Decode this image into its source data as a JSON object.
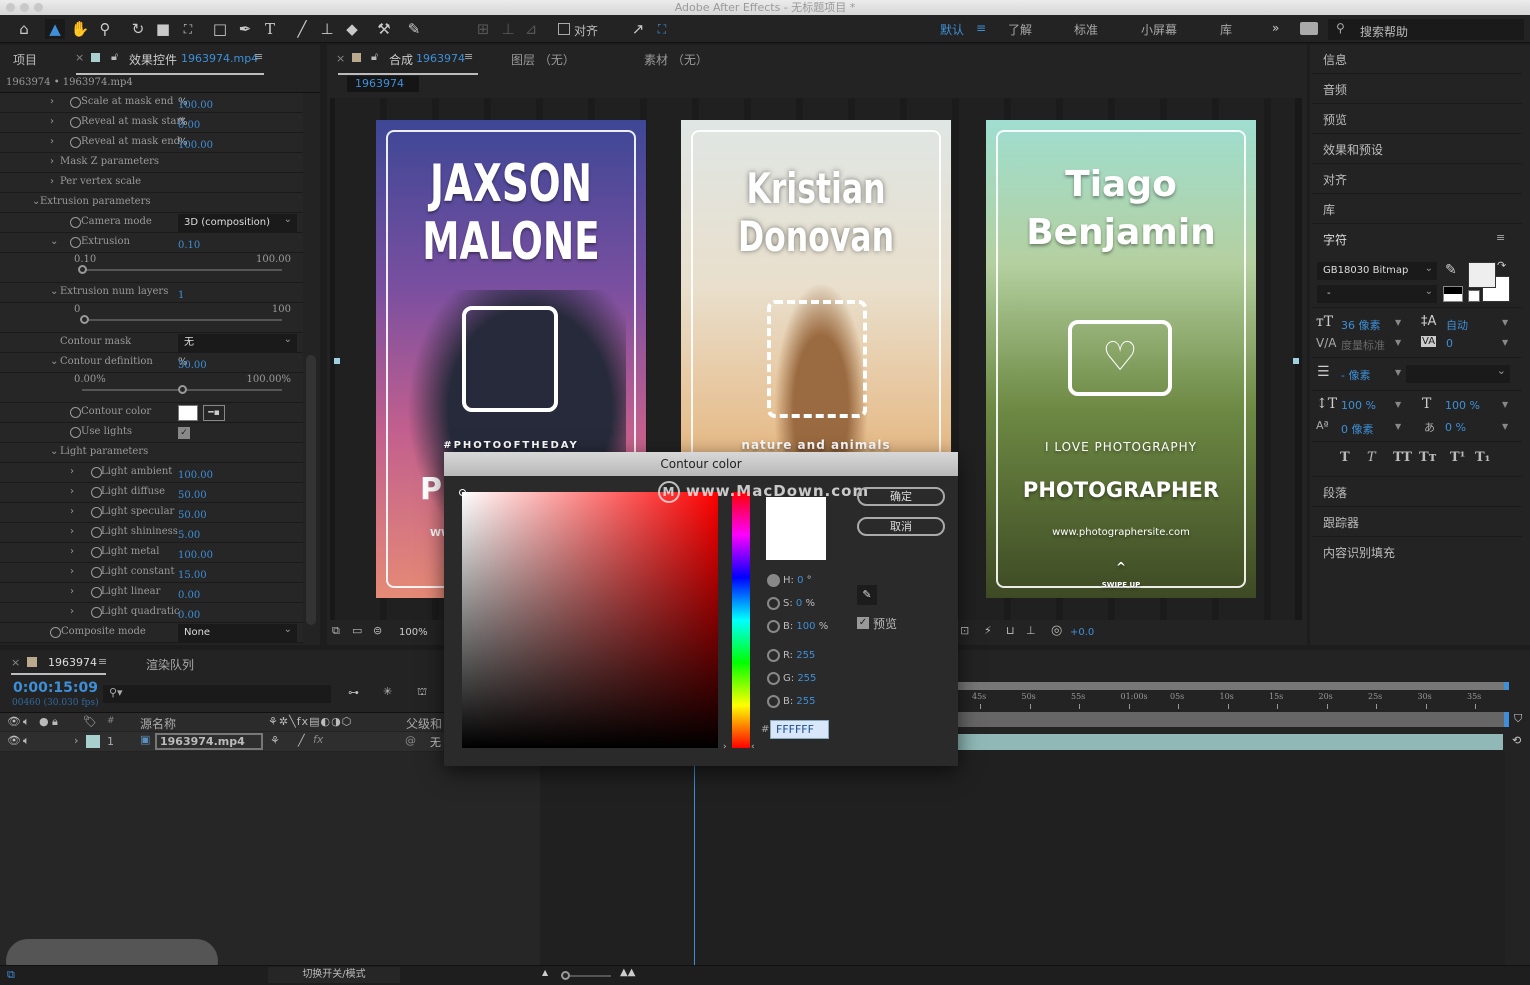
{
  "window": {
    "title": "Adobe After Effects - 无标题项目 *"
  },
  "toolbar": {
    "tools": [
      "home-icon",
      "selection-icon",
      "hand-icon",
      "zoom-icon",
      "rotate-icon",
      "camera-icon",
      "pan-behind-icon",
      "rectangle-icon",
      "pen-icon",
      "text-icon",
      "brush-icon",
      "clone-stamp-icon",
      "eraser-icon",
      "roto-brush-icon",
      "puppet-pin-icon"
    ],
    "align_label": "对齐",
    "workspaces": [
      "默认",
      "了解",
      "标准",
      "小屏幕",
      "库"
    ],
    "active_workspace": "默认",
    "more": "»",
    "search_placeholder": "搜索帮助"
  },
  "left_panel": {
    "tab_project": "项目",
    "tab_effects": "效果控件",
    "tab_effects_file": "1963974.mp4",
    "breadcrumb": "1963974 • 1963974.mp4",
    "rows": [
      {
        "label": "Scale at mask end",
        "value": "100.00",
        "unit": "%",
        "lvl": 2,
        "arrow": ">",
        "sw": true
      },
      {
        "label": "Reveal at mask start",
        "value": "0.00",
        "unit": "%",
        "lvl": 2,
        "arrow": ">",
        "sw": true
      },
      {
        "label": "Reveal at mask end",
        "value": "100.00",
        "unit": "%",
        "lvl": 2,
        "arrow": ">",
        "sw": true
      },
      {
        "label": "Mask Z parameters",
        "lvl": 1.5,
        "arrow": ">"
      },
      {
        "label": "Per vertex scale",
        "lvl": 1.5,
        "arrow": ">"
      },
      {
        "label": "Extrusion parameters",
        "lvl": 1,
        "arrow": "v"
      },
      {
        "label": "Camera mode",
        "dropdown": "3D (composition)",
        "lvl": 2,
        "sw": true
      },
      {
        "label": "Extrusion",
        "value": "0.10",
        "lvl": 2,
        "arrow": "v",
        "sw": true
      },
      {
        "slider": true,
        "min": "0.10",
        "max": "100.00",
        "pos": 0
      },
      {
        "label": "Extrusion num layers",
        "value": "1",
        "lvl": 1.5,
        "arrow": "v"
      },
      {
        "slider": true,
        "min": "0",
        "max": "100",
        "pos": 0.01
      },
      {
        "label": "Contour mask",
        "dropdown": "无",
        "lvl": 1.5
      },
      {
        "label": "Contour definition",
        "value": "50.00",
        "unit": "%",
        "lvl": 1.5,
        "arrow": "v"
      },
      {
        "slider": true,
        "min": "0.00%",
        "max": "100.00%",
        "pos": 0.5
      },
      {
        "label": "Contour color",
        "color": "#ffffff",
        "lvl": 2,
        "sw": true
      },
      {
        "label": "Use lights",
        "checkbox": true,
        "lvl": 2,
        "sw": true
      },
      {
        "label": "Light parameters",
        "lvl": 1.5,
        "arrow": "v"
      },
      {
        "label": "Light ambient",
        "value": "100.00",
        "lvl": 3,
        "arrow": ">",
        "sw": true
      },
      {
        "label": "Light diffuse",
        "value": "50.00",
        "lvl": 3,
        "arrow": ">",
        "sw": true
      },
      {
        "label": "Light specular",
        "value": "50.00",
        "lvl": 3,
        "arrow": ">",
        "sw": true
      },
      {
        "label": "Light shininess",
        "value": "5.00",
        "lvl": 3,
        "arrow": ">",
        "sw": true
      },
      {
        "label": "Light metal",
        "value": "100.00",
        "lvl": 3,
        "arrow": ">",
        "sw": true
      },
      {
        "label": "Light constant",
        "value": "15.00",
        "lvl": 3,
        "arrow": ">",
        "sw": true
      },
      {
        "label": "Light linear",
        "value": "0.00",
        "lvl": 3,
        "arrow": ">",
        "sw": true
      },
      {
        "label": "Light quadratic",
        "value": "0.00",
        "lvl": 3,
        "arrow": ">",
        "sw": true
      },
      {
        "label": "Composite mode",
        "dropdown": "None",
        "lvl": 0.5,
        "sw": true
      }
    ]
  },
  "comp_panel": {
    "tab_label": "合成",
    "tab_comp": "1963974",
    "tab_layer": "图层 （无）",
    "tab_footage": "素材 （无）",
    "comp_chip": "1963974",
    "zoom": "100%",
    "exposure": "+0.0",
    "cards": [
      {
        "title1": "JAXSON",
        "title2": "MALONE",
        "tagline": "#PHOTOOFTHEDAY",
        "line1": "PH",
        "line2": "WW"
      },
      {
        "title1": "Kristian",
        "title2": "Donovan",
        "tagline": "nature and animals"
      },
      {
        "title1": "Tiago",
        "title2": "Benjamin",
        "tagline": "I LOVE PHOTOGRAPHY",
        "headline": "PHOTOGRAPHER",
        "url": "www.photographersite.com",
        "cta": "SWIPE UP"
      }
    ]
  },
  "right_panel": {
    "items": [
      "信息",
      "音频",
      "预览",
      "效果和预设",
      "对齐",
      "库"
    ],
    "character": {
      "title": "字符",
      "font": "GB18030 Bitmap",
      "style": "-",
      "size": "36 像素",
      "leading": "自动",
      "kerning": "度量标准",
      "tracking": "0",
      "stroke": "- 像素",
      "vscale": "100 %",
      "hscale": "100 %",
      "baseline": "0 像素",
      "tsume": "0 %",
      "styles": [
        "T",
        "T",
        "TT",
        "Tт",
        "T¹",
        "T₁"
      ]
    },
    "bottom_items": [
      "段落",
      "跟踪器",
      "内容识别填充"
    ]
  },
  "timeline": {
    "tab_comp": "1963974",
    "tab_render": "渲染队列",
    "timecode": "0:00:15:09",
    "frame_info": "00460 (30.030 fps)",
    "search_placeholder": "",
    "col_source": "源名称",
    "col_parent": "父级和",
    "layer": {
      "index": "1",
      "name": "1963974.mp4",
      "parent": "无",
      "color": "#a8d0cc"
    },
    "ruler": [
      "45s",
      "50s",
      "55s",
      "01:00s",
      "05s",
      "10s",
      "15s",
      "20s",
      "25s",
      "30s",
      "35s"
    ],
    "toggle_label": "切换开关/模式"
  },
  "dialog": {
    "title": "Contour color",
    "ok": "确定",
    "cancel": "取消",
    "h_label": "H:",
    "h": "0",
    "h_unit": "°",
    "s_label": "S:",
    "s": "0",
    "s_unit": "%",
    "b_label": "B:",
    "b": "100",
    "b_unit": "%",
    "r_label": "R:",
    "r": "255",
    "g_label": "G:",
    "g": "255",
    "b2_label": "B:",
    "b2": "255",
    "hash": "#",
    "hex": "FFFFFF",
    "preview_label": "预览",
    "preview_checked": true,
    "selected_color": "#ffffff"
  },
  "watermark": "www.MacDown.com"
}
